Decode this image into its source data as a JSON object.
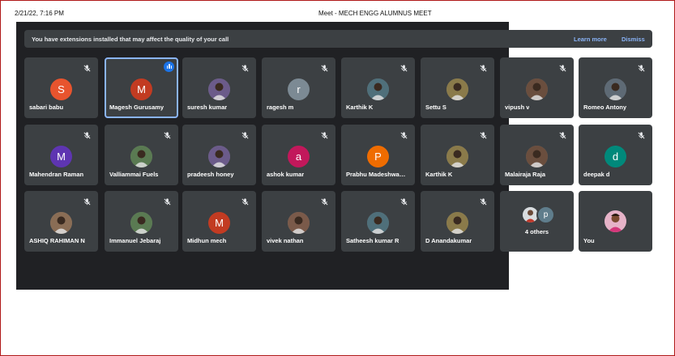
{
  "print_header": {
    "date": "2/21/22, 7:16 PM",
    "title": "Meet - MECH ENGG ALUMNUS MEET"
  },
  "notice": {
    "text": "You have extensions installed that may affect the quality of your call",
    "learn_more": "Learn more",
    "dismiss": "Dismiss"
  },
  "participants": [
    {
      "name": "sabari babu",
      "initial": "S",
      "color": "#e8542e",
      "muted": true
    },
    {
      "name": "Magesh Gurusamy",
      "initial": "M",
      "color": "#c23b22",
      "muted": false,
      "speaking": true
    },
    {
      "name": "suresh kumar",
      "photo": true,
      "muted": true
    },
    {
      "name": "ragesh m",
      "initial": "r",
      "color": "#7c8a94",
      "muted": true
    },
    {
      "name": "Karthik K",
      "photo": true,
      "muted": true
    },
    {
      "name": "Settu S",
      "photo": true,
      "muted": true
    },
    {
      "name": "vipush v",
      "photo": true,
      "muted": true
    },
    {
      "name": "Romeo Antony",
      "photo": true,
      "muted": true
    },
    {
      "name": "Mahendran Raman",
      "initial": "M",
      "color": "#5e35b1",
      "muted": true
    },
    {
      "name": "Valliammai Fuels",
      "photo": true,
      "muted": true
    },
    {
      "name": "pradeesh honey",
      "photo": true,
      "muted": true
    },
    {
      "name": "ashok kumar",
      "initial": "a",
      "color": "#c2185b",
      "muted": true
    },
    {
      "name": "Prabhu Madeshwa…",
      "initial": "P",
      "color": "#ef6c00",
      "muted": true
    },
    {
      "name": "Karthik K",
      "photo": true,
      "muted": true
    },
    {
      "name": "Malairaja Raja",
      "photo": true,
      "muted": true
    },
    {
      "name": "deepak d",
      "initial": "d",
      "color": "#00897b",
      "muted": true
    },
    {
      "name": "ASHIQ RAHIMAN N",
      "photo": true,
      "muted": true
    },
    {
      "name": "Immanuel Jebaraj",
      "photo": true,
      "muted": true
    },
    {
      "name": "Midhun mech",
      "initial": "M",
      "color": "#c23b22",
      "muted": true
    },
    {
      "name": "vivek nathan",
      "photo": true,
      "muted": true
    },
    {
      "name": "Satheesh kumar R",
      "photo": true,
      "muted": true
    },
    {
      "name": "D Anandakumar",
      "photo": true,
      "muted": true
    }
  ],
  "others": {
    "label": "4 others",
    "initial": "p",
    "initial_color": "#5f7d8c"
  },
  "self": {
    "label": "You"
  }
}
